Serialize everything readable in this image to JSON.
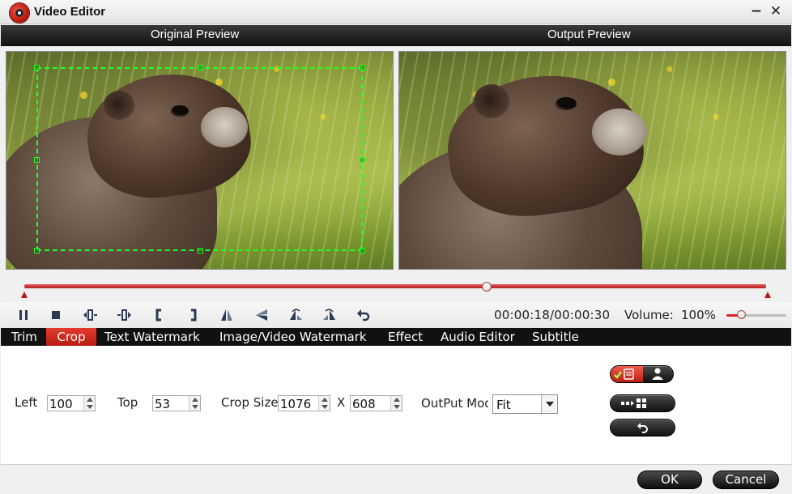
{
  "window": {
    "title": "Video Editor",
    "minimize": "−",
    "close": "✕"
  },
  "preview": {
    "original_label": "Original Preview",
    "output_label": "Output Preview"
  },
  "playback": {
    "time": "00:00:18/00:00:30",
    "volume_label": "Volume:",
    "volume_value": "100%",
    "progress_fraction": 0.62,
    "volume_fraction": 0.25
  },
  "toolbar": {
    "icons": [
      "pause-icon",
      "stop-icon",
      "previous-frame-icon",
      "next-frame-icon",
      "set-start-icon",
      "set-end-icon",
      "flip-horizontal-icon",
      "flip-vertical-icon",
      "rotate-left-icon",
      "rotate-right-icon",
      "undo-icon"
    ]
  },
  "tabs": [
    {
      "label": "Trim",
      "active": false
    },
    {
      "label": "Crop",
      "active": true
    },
    {
      "label": "Text Watermark",
      "active": false
    },
    {
      "label": "Image/Video Watermark",
      "active": false
    },
    {
      "label": "Effect",
      "active": false
    },
    {
      "label": "Audio Editor",
      "active": false
    },
    {
      "label": "Subtitle",
      "active": false
    }
  ],
  "crop": {
    "left_label": "Left",
    "left_value": "100",
    "top_label": "Top",
    "top_value": "53",
    "size_label": "Crop Size",
    "width_value": "1076",
    "x_label": "X",
    "height_value": "608",
    "output_mode_label": "OutPut Mode",
    "output_mode_value": "Fit"
  },
  "footer": {
    "ok": "OK",
    "cancel": "Cancel"
  },
  "colors": {
    "accent_red": "#c41e15",
    "crop_box": "#22ff22"
  }
}
